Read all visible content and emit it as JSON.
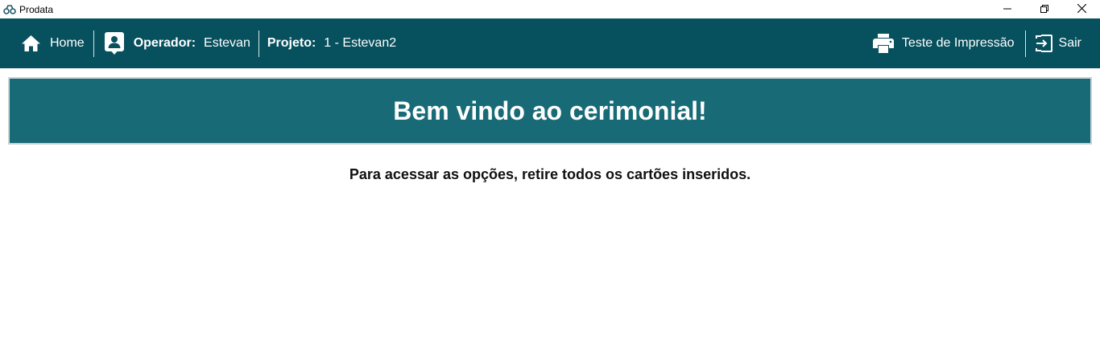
{
  "window": {
    "title": "Prodata",
    "controls": {
      "minimize_icon": "minimize-icon",
      "restore_icon": "restore-icon",
      "close_icon": "close-icon"
    }
  },
  "navbar": {
    "background": "#07505e",
    "home": {
      "label": "Home",
      "icon": "home-icon"
    },
    "operator": {
      "label": "Operador:",
      "value": "Estevan",
      "icon": "user-badge-icon"
    },
    "project": {
      "label": "Projeto:",
      "value": "1 - Estevan2"
    },
    "print_test": {
      "label": "Teste de Impressão",
      "icon": "printer-icon"
    },
    "exit": {
      "label": "Sair",
      "icon": "exit-icon"
    }
  },
  "banner": {
    "title": "Bem vindo ao cerimonial!",
    "background": "#186b76"
  },
  "message": "Para acessar as opções, retire todos os cartões inseridos."
}
